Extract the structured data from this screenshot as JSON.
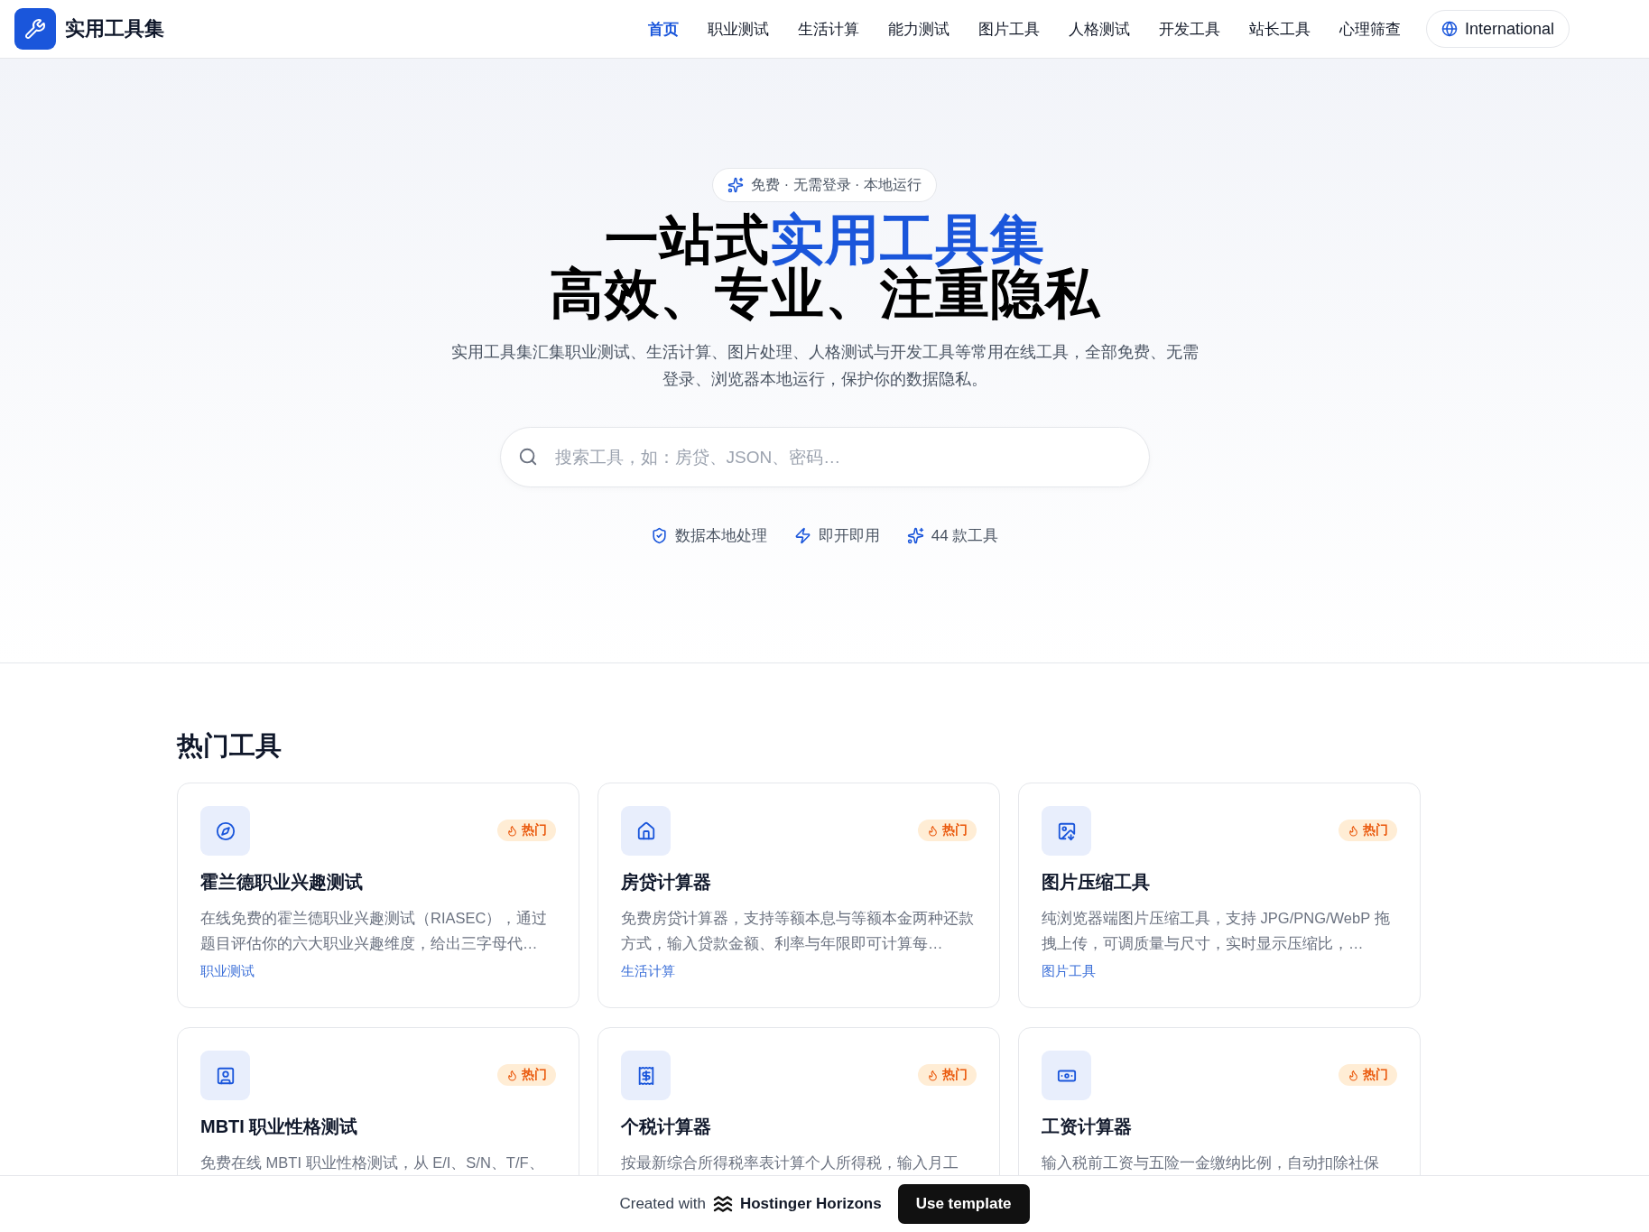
{
  "brand": {
    "name": "实用工具集"
  },
  "nav": [
    {
      "label": "首页",
      "selected": true
    },
    {
      "label": "职业测试",
      "selected": false
    },
    {
      "label": "生活计算",
      "selected": false
    },
    {
      "label": "能力测试",
      "selected": false
    },
    {
      "label": "图片工具",
      "selected": false
    },
    {
      "label": "人格测试",
      "selected": false
    },
    {
      "label": "开发工具",
      "selected": false
    },
    {
      "label": "站长工具",
      "selected": false
    },
    {
      "label": "心理筛查",
      "selected": false
    }
  ],
  "language_button": "International",
  "hero": {
    "badge": "免费 · 无需登录 · 本地运行",
    "title_plain": "一站式",
    "title_accent": "实用工具集",
    "title_line2": "高效、专业、注重隐私",
    "description": "实用工具集汇集职业测试、生活计算、图片处理、人格测试与开发工具等常用在线工具，全部免费、无需登录、浏览器本地运行，保护你的数据隐私。",
    "search": {
      "placeholder": "搜索工具，如：房贷、JSON、密码…"
    },
    "features": [
      "数据本地处理",
      "即开即用",
      "44 款工具"
    ]
  },
  "popular": {
    "heading": "热门工具",
    "cards": [
      {
        "title": "霍兰德职业兴趣测试",
        "badge": "热门",
        "description": "在线免费的霍兰德职业兴趣测试（RIASEC），通过题目评估你的六大职业兴趣维度，给出三字母代…",
        "category": "职业测试"
      },
      {
        "title": "房贷计算器",
        "badge": "热门",
        "description": "免费房贷计算器，支持等额本息与等额本金两种还款方式，输入贷款金额、利率与年限即可计算每…",
        "category": "生活计算"
      },
      {
        "title": "图片压缩工具",
        "badge": "热门",
        "description": "纯浏览器端图片压缩工具，支持 JPG/PNG/WebP 拖拽上传，可调质量与尺寸，实时显示压缩比，…",
        "category": "图片工具"
      },
      {
        "title": "MBTI 职业性格测试",
        "badge": "热门",
        "description": "免费在线 MBTI 职业性格测试，从 E/I、S/N、T/F、"
      },
      {
        "title": "个税计算器",
        "badge": "热门",
        "description": "按最新综合所得税率表计算个人所得税，输入月工"
      },
      {
        "title": "工资计算器",
        "badge": "热门",
        "description": "输入税前工资与五险一金缴纳比例，自动扣除社保"
      }
    ]
  },
  "footer_bar": {
    "created_with": "Created with",
    "brand": "Hostinger Horizons",
    "button": "Use template"
  }
}
